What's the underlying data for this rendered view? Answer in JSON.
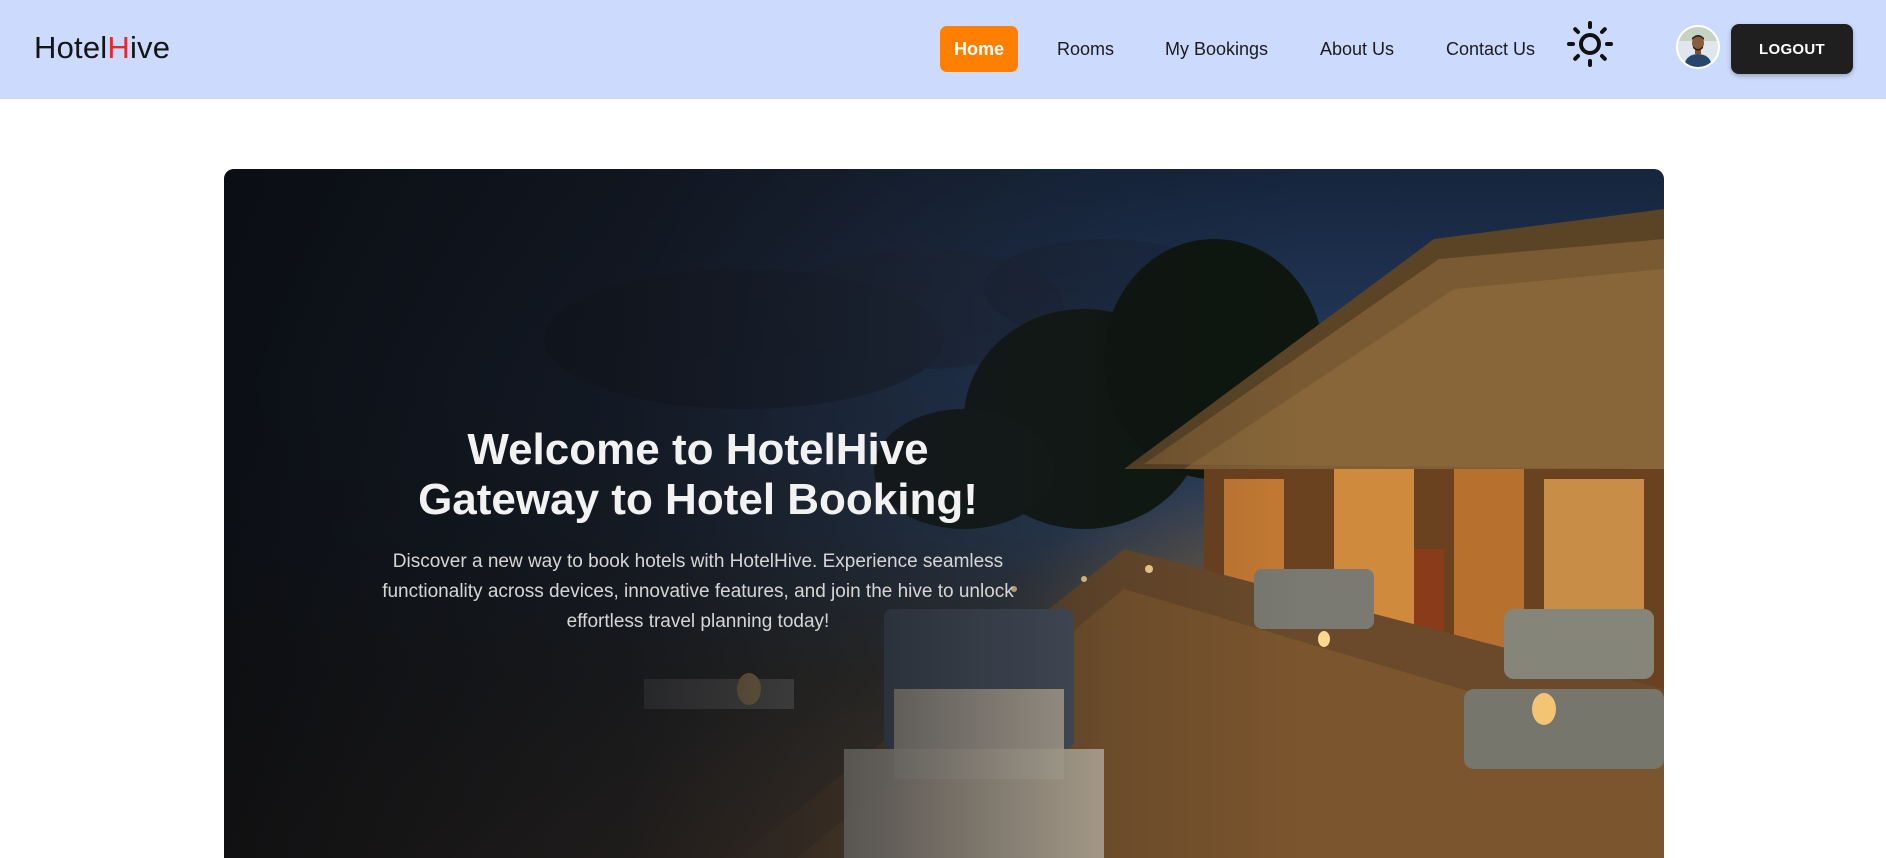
{
  "brand": {
    "prefix": "Hotel",
    "accent": "H",
    "suffix": "ive",
    "accent_color": "#e32d2d"
  },
  "nav": {
    "items": [
      {
        "label": "Home",
        "active": true
      },
      {
        "label": "Rooms",
        "active": false
      },
      {
        "label": "My Bookings",
        "active": false
      },
      {
        "label": "About Us",
        "active": false
      },
      {
        "label": "Contact Us",
        "active": false
      }
    ],
    "active_color": "#ff7f00",
    "theme_toggle_icon": "sun-icon",
    "logout_label": "LOGOUT"
  },
  "hero": {
    "title_line1": "Welcome to HotelHive",
    "title_line2": "Gateway to Hotel Booking!",
    "subtitle": "Discover a new way to book hotels with HotelHive. Experience seamless functionality across devices, innovative features, and join the hive to unlock effortless travel planning today!"
  },
  "colors": {
    "navbar_bg": "#ccdafd",
    "logout_bg": "#1f1f1f"
  }
}
